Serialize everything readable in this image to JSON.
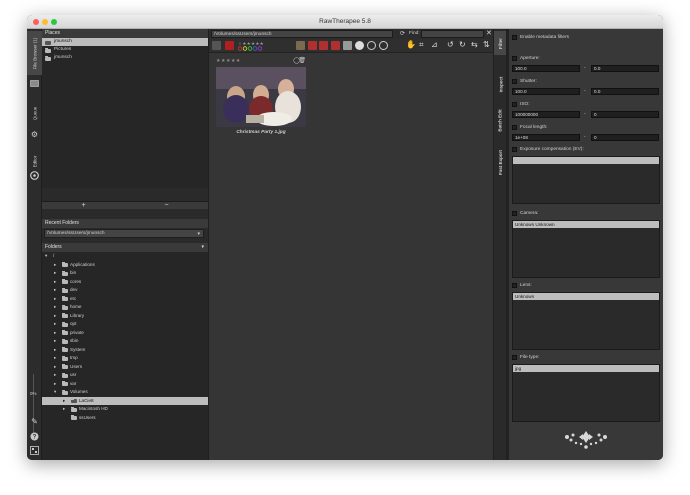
{
  "window": {
    "title": "RawTherapee 5.8"
  },
  "left_tabs": {
    "file_browser": "File Browser (1)",
    "queue": "Queue",
    "editor": "Editor",
    "zoom_percent": "0%"
  },
  "places": {
    "header": "Places",
    "items": [
      {
        "label": "jmunsch",
        "selected": true
      },
      {
        "label": "Pictures",
        "selected": false
      },
      {
        "label": "jmunsch",
        "selected": false
      }
    ],
    "add_label": "+",
    "remove_label": "−"
  },
  "recent": {
    "header": "Recent Folders",
    "value": "/Volumes/ssUsers/jmunsch"
  },
  "folders": {
    "header": "Folders",
    "tree": [
      {
        "label": "/",
        "depth": 0,
        "expanded": true,
        "folder": false
      },
      {
        "label": "Applications",
        "depth": 1,
        "expanded": false,
        "folder": true
      },
      {
        "label": "bin",
        "depth": 1,
        "expanded": false,
        "folder": true
      },
      {
        "label": "cores",
        "depth": 1,
        "expanded": false,
        "folder": true
      },
      {
        "label": "dev",
        "depth": 1,
        "expanded": false,
        "folder": true
      },
      {
        "label": "etc",
        "depth": 1,
        "expanded": false,
        "folder": true
      },
      {
        "label": "home",
        "depth": 1,
        "expanded": false,
        "folder": true
      },
      {
        "label": "Library",
        "depth": 1,
        "expanded": false,
        "folder": true
      },
      {
        "label": "opt",
        "depth": 1,
        "expanded": false,
        "folder": true
      },
      {
        "label": "private",
        "depth": 1,
        "expanded": false,
        "folder": true
      },
      {
        "label": "sbin",
        "depth": 1,
        "expanded": false,
        "folder": true
      },
      {
        "label": "System",
        "depth": 1,
        "expanded": false,
        "folder": true
      },
      {
        "label": "tmp",
        "depth": 1,
        "expanded": false,
        "folder": true
      },
      {
        "label": "Users",
        "depth": 1,
        "expanded": false,
        "folder": true
      },
      {
        "label": "usr",
        "depth": 1,
        "expanded": false,
        "folder": true
      },
      {
        "label": "var",
        "depth": 1,
        "expanded": false,
        "folder": true
      },
      {
        "label": "Volumes",
        "depth": 1,
        "expanded": true,
        "folder": true
      },
      {
        "label": "LaCie8",
        "depth": 2,
        "expanded": false,
        "folder": true,
        "selected": true
      },
      {
        "label": "Macintosh HD",
        "depth": 2,
        "expanded": false,
        "folder": true
      },
      {
        "label": "ssUsers",
        "depth": 2,
        "expanded": false,
        "folder": true,
        "no_arrow": true
      }
    ]
  },
  "browser": {
    "path": "/Volumes/ssUsers/jmunsch",
    "find_label": "Find:",
    "find_value": "",
    "thumbnail": {
      "caption": "Christmas Party 1.jpg",
      "stars": "★★★★★"
    }
  },
  "right_tabs": {
    "filter": "Filter",
    "inspect": "Inspect",
    "batch_edit": "Batch Edit",
    "fast_export": "Fast Export"
  },
  "filter": {
    "enable_label": "Enable metadata filters",
    "aperture": {
      "label": "Aperture:",
      "min": "100.0",
      "max": "0.0"
    },
    "shutter": {
      "label": "Shutter:",
      "min": "100.0",
      "max": "0.0"
    },
    "iso": {
      "label": "ISO:",
      "min": "100000000",
      "max": "0"
    },
    "focal": {
      "label": "Focal length:",
      "min": "1e+08",
      "max": "0"
    },
    "exposure": {
      "label": "Exposure compensation (EV):"
    },
    "camera": {
      "label": "Camera:",
      "value": "Unknown Unknown"
    },
    "lens": {
      "label": "Lens:",
      "value": "Unknown"
    },
    "filetype": {
      "label": "File type:",
      "value": "jpg"
    },
    "dash": "-"
  }
}
